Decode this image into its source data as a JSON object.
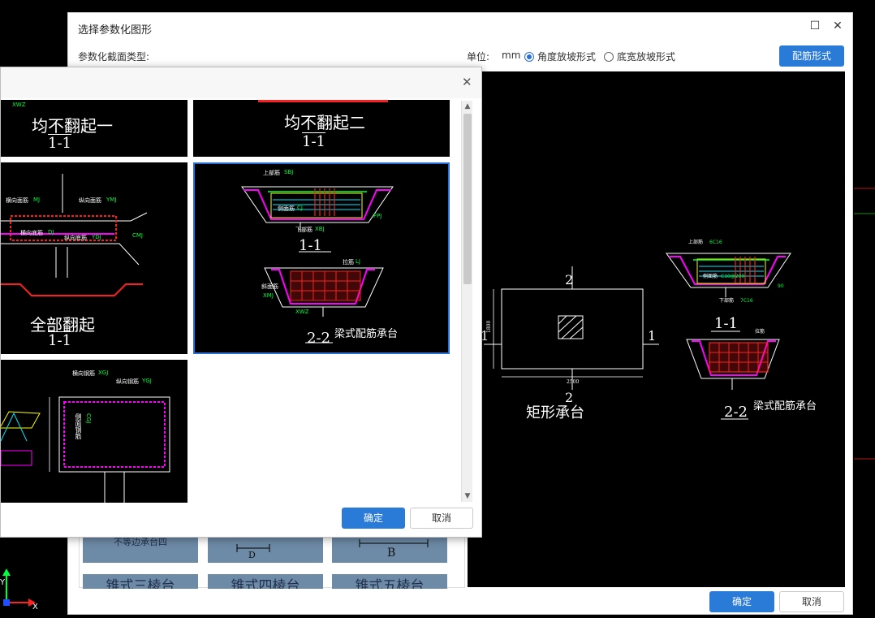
{
  "main_window": {
    "title": "选择参数化图形",
    "section_type_label": "参数化截面类型:",
    "unit_label": "单位:",
    "unit_value": "mm",
    "radio_angle": "角度放坡形式",
    "radio_width": "底宽放坡形式",
    "rebar_form_button": "配筋形式",
    "ok_button": "确定",
    "cancel_button": "取消",
    "maximize_glyph": "☐",
    "close_glyph": "✕"
  },
  "tiles": [
    {
      "label": "不等边承台四"
    },
    {
      "label": "D"
    },
    {
      "label": "B"
    },
    {
      "label": "锥式三棱台"
    },
    {
      "label": "锥式四棱台"
    },
    {
      "label": "锥式五棱台"
    }
  ],
  "preview": {
    "label_22_top": "2",
    "label_11_left": "1",
    "label_11_right": "1",
    "label_22_bottom": "2",
    "dim_width": "2500",
    "dim_height": "1800",
    "name": "矩形承台",
    "section_11": "1-1",
    "section_22": "2-2",
    "style_name": "梁式配筋承台",
    "top_bar": "上部筋",
    "top_bar_value": "6C16",
    "side_bar": "侧面筋",
    "side_bar_value": "C10@200",
    "bottom_bar": "下部筋",
    "bottom_bar_value": "7C16",
    "tie_bar": "拉筋",
    "dim_90": "90"
  },
  "dialog": {
    "close_glyph": "✕",
    "ok_button": "确定",
    "cancel_button": "取消",
    "cells": [
      {
        "title": "均不翻起一",
        "section": "1-1",
        "tag": "XWZ"
      },
      {
        "title": "均不翻起二",
        "section": "1-1"
      },
      {
        "title": "全部翻起",
        "section": "1-1",
        "horiz_face": "横向面筋",
        "horiz_face_code": "MJ",
        "long_face": "纵向面筋",
        "long_face_code": "YMJ",
        "horiz_bottom": "横向底筋",
        "horiz_bottom_code": "DJ",
        "long_bottom": "纵向底筋",
        "long_bottom_code": "YDJ",
        "cmj": "CMJ"
      },
      {
        "title": "梁式配筋承台",
        "section_a": "1-1",
        "section_b": "2-2",
        "top_bar": "上部筋",
        "top_bar_code": "SBJ",
        "side_bar": "侧面筋",
        "side_bar_code": "CJ",
        "bottom_bar": "下部筋",
        "bottom_bar_code": "XBJ",
        "tie": "拉筋",
        "tie_code": "LJ",
        "slope": "斜面筋",
        "xmj": "XMJ",
        "xwz": "XWZ",
        "fpj": "FPJ"
      },
      {
        "horiz": "横向钢筋",
        "horiz_code": "XGJ",
        "long": "纵向钢筋",
        "long_code": "YGJ",
        "side": "侧面钢筋",
        "side_code": "CGJ"
      }
    ]
  },
  "colors": {
    "accent": "#2a7ad8",
    "cad_red": "#ff1e1e",
    "cad_magenta": "#ff00ff",
    "cad_green": "#00ff3c",
    "cad_yellow": "#ffff00",
    "cad_cyan": "#00e5ff"
  }
}
